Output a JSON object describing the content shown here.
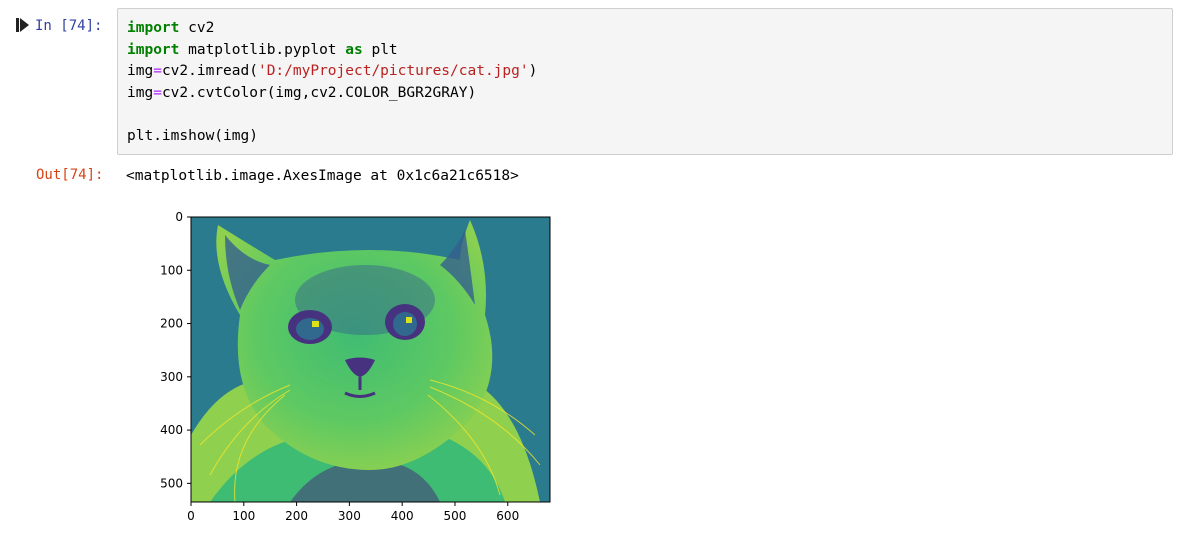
{
  "cell": {
    "in_prompt": "In [74]:",
    "out_prompt": "Out[74]:",
    "code_lines": [
      [
        {
          "t": "kw",
          "v": "import"
        },
        {
          "t": "plain",
          "v": " cv2"
        }
      ],
      [
        {
          "t": "kw",
          "v": "import"
        },
        {
          "t": "plain",
          "v": " matplotlib.pyplot "
        },
        {
          "t": "kw",
          "v": "as"
        },
        {
          "t": "plain",
          "v": " plt"
        }
      ],
      [
        {
          "t": "plain",
          "v": "img"
        },
        {
          "t": "op",
          "v": "="
        },
        {
          "t": "plain",
          "v": "cv2.imread("
        },
        {
          "t": "str",
          "v": "'D:/myProject/pictures/cat.jpg'"
        },
        {
          "t": "plain",
          "v": ")"
        }
      ],
      [
        {
          "t": "plain",
          "v": "img"
        },
        {
          "t": "op",
          "v": "="
        },
        {
          "t": "plain",
          "v": "cv2.cvtColor(img,cv2.COLOR_BGR2GRAY)"
        }
      ],
      [],
      [
        {
          "t": "plain",
          "v": "plt.imshow(img)"
        }
      ]
    ],
    "output_text": "<matplotlib.image.AxesImage at 0x1c6a21c6518>"
  },
  "plot": {
    "colors": {
      "background": "#2a7b8e",
      "fur_light": "#8fd14f",
      "fur_mid": "#3fbc73",
      "fur_dark": "#35608d",
      "dark": "#46327e",
      "yellow": "#dde318"
    }
  },
  "chart_data": {
    "type": "image",
    "x_ticks": [
      "0",
      "100",
      "200",
      "300",
      "400",
      "500",
      "600"
    ],
    "y_ticks": [
      "0",
      "100",
      "200",
      "300",
      "400",
      "500"
    ],
    "xlim": [
      0,
      680
    ],
    "ylim": [
      535,
      0
    ]
  }
}
